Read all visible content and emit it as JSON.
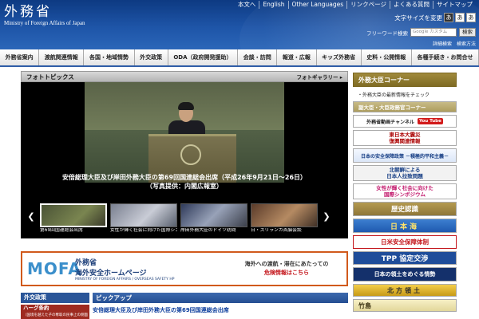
{
  "header": {
    "logo_title": "外務省",
    "logo_sub": "Ministry of Foreign Affairs of Japan",
    "top_links": [
      "本文へ",
      "English",
      "Other Languages",
      "リンクページ",
      "よくある質問",
      "サイトマップ"
    ],
    "font_size_label": "文字サイズを変更",
    "font_sizes": [
      "あ",
      "あ",
      "あ"
    ],
    "search_label": "フリーワード検索",
    "search_placeholder": "Google カスタム",
    "search_button": "検索",
    "search_links": [
      "詳細検索",
      "検索方法"
    ]
  },
  "gnav": [
    "外務省案内",
    "渡航関連情報",
    "各国・地域情勢",
    "外交政策",
    "ODA（政府開発援助）",
    "会談・訪問",
    "報道・広報",
    "キッズ外務省",
    "史料・公開情報",
    "各種手続き・お問合せ"
  ],
  "photo_topics": {
    "title": "フォトトピックス",
    "gallery": "フォトギャラリー ▸",
    "caption_line1": "安倍総理大臣及び岸田外務大臣の第69回国連総会出席（平成26年9月21日～26日）",
    "caption_line2": "（写真提供：内閣広報室）",
    "prev": "❮",
    "next": "❯",
    "thumbs": [
      {
        "label": "第69回国連総会出席"
      },
      {
        "label": "女性が輝く社会に向けた国際シンポジウム"
      },
      {
        "label": "岸田外務大臣のドイツ訪問"
      },
      {
        "label": "日・スリランカ首脳会談"
      }
    ]
  },
  "banner": {
    "logo": "MOFA",
    "line1": "外務省",
    "line2": "海外安全ホームページ",
    "line3": "MINISTRY OF FOREIGN AFFAIRS / OVERSEAS SAFETY HP",
    "right1": "海外への渡航・滞在にあたっての",
    "right2": "危険情報はこちら"
  },
  "gaiko": {
    "title": "外交政策",
    "item_main": "ハーグ条約",
    "item_sub": "（国境を越えた子の奪取の民事上の側面に関する条約）"
  },
  "pickup": {
    "title": "ピックアップ",
    "link": "安倍総理大臣及び岸田外務大臣の第69回国連総会出席"
  },
  "right": {
    "minister_head": "外務大臣コーナー",
    "minister_info": "・外務大臣の最新情報をチェック",
    "vice": "副大臣・大臣政務官コーナー",
    "video": "外務省動画チャンネル",
    "video_badge": "You Tube",
    "quake1": "東日本大震災",
    "quake2": "復興関連情報",
    "security": "日本の安全保障政策 －積極的平和主義－",
    "nk1": "北朝鮮による",
    "nk2": "日本人拉致問題",
    "women1": "女性が輝く社会に向けた",
    "women2": "国際シンポジウム",
    "history": "歴史認識",
    "nihonkai": "日本海",
    "anpo": "日米安全保障体制",
    "tpp": "TPP 協定交渉",
    "ryodo": "日本の領土をめぐる情勢",
    "hoppo": "北方領土",
    "takeshima": "竹島"
  }
}
